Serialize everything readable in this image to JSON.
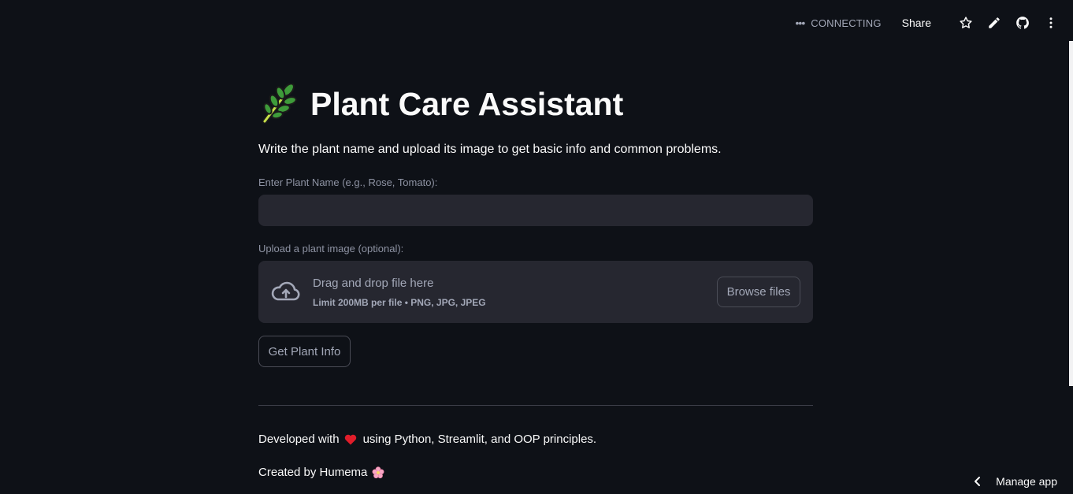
{
  "toolbar": {
    "status_dots": "•••",
    "status_text": "CONNECTING",
    "share_label": "Share"
  },
  "main": {
    "title": "Plant Care Assistant",
    "subtitle": "Write the plant name and upload its image to get basic info and common problems.",
    "plant_name_label": "Enter Plant Name (e.g., Rose, Tomato):",
    "plant_name_value": "",
    "upload_label": "Upload a plant image (optional):",
    "dropzone_text": "Drag and drop file here",
    "dropzone_limit": "Limit 200MB per file • PNG, JPG, JPEG",
    "browse_label": "Browse files",
    "submit_label": "Get Plant Info"
  },
  "footer": {
    "developed_prefix": "Developed with",
    "developed_suffix": "using Python, Streamlit, and OOP principles.",
    "created_by": "Created by Humema"
  },
  "manage_app": {
    "label": "Manage app"
  },
  "colors": {
    "background": "#0e1117",
    "input_bg": "#262730",
    "text": "#fafafa",
    "muted": "#a3a8b8",
    "heart": "#e11d2a"
  }
}
